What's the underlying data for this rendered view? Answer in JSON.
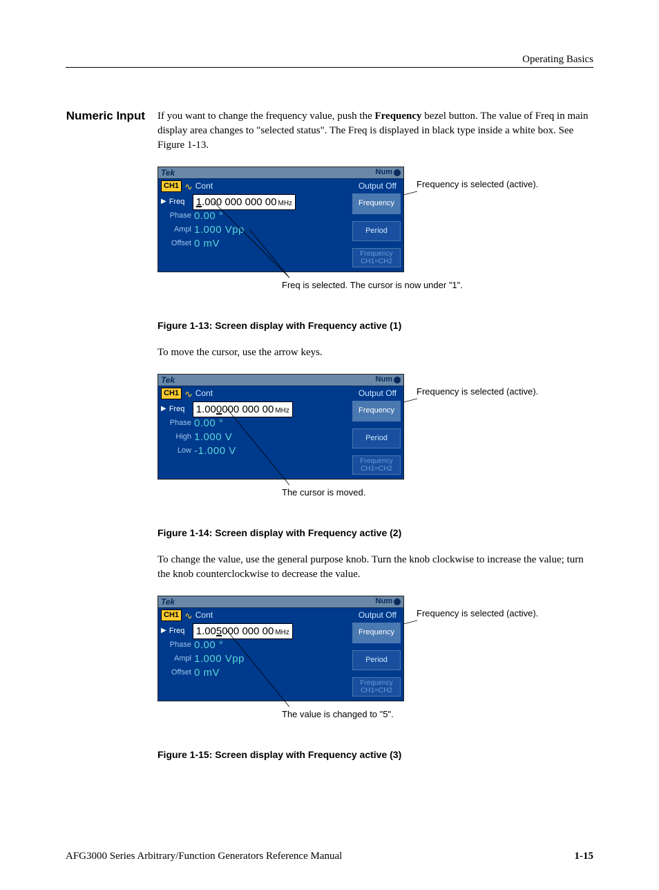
{
  "header": {
    "title": "Operating Basics"
  },
  "section": {
    "title": "Numeric Input",
    "para1_a": "If you want to change the frequency value, push the ",
    "para1_bold": "Frequency",
    "para1_b": " bezel button. The value of Freq in main display area changes to \"selected status\". The Freq is displayed in black type inside a white box. See Figure 1-13."
  },
  "fig1": {
    "top_brand": "Tek",
    "top_num": "Num",
    "ch1": "CH1",
    "cont": "Cont",
    "output": "Output Off",
    "freq_label": "Freq",
    "freq_value_lead": "1",
    "freq_value_rest": ".000 000 000 00",
    "freq_unit": "MHz",
    "phase_label": "Phase",
    "phase_value": "0.00 °",
    "ampl_label": "Ampl",
    "ampl_value": "1.000 Vpp",
    "offset_label": "Offset",
    "offset_value": "0 mV",
    "menu_freq": "Frequency",
    "menu_period": "Period",
    "menu_fcc": "Frequency\nCH1=CH2",
    "side_annot": "Frequency is selected (active).",
    "below_annot": "Freq is selected. The cursor is now under \"1\".",
    "caption": "Figure 1-13: Screen display with Frequency active (1)"
  },
  "para2": "To move the cursor, use the arrow keys.",
  "fig2": {
    "top_brand": "Tek",
    "top_num": "Num",
    "ch1": "CH1",
    "cont": "Cont",
    "output": "Output Off",
    "freq_label": "Freq",
    "freq_value_pre": "1.00",
    "freq_value_cursor": "0",
    "freq_value_post": " 000 000 00",
    "freq_unit": "MHz",
    "phase_label": "Phase",
    "phase_value": "0.00 °",
    "high_label": "High",
    "high_value": "1.000 V",
    "low_label": "Low",
    "low_value": "-1.000 V",
    "menu_freq": "Frequency",
    "menu_period": "Period",
    "menu_fcc": "Frequency\nCH1=CH2",
    "side_annot": "Frequency is selected (active).",
    "below_annot": "The cursor is moved.",
    "caption": "Figure 1-14: Screen display with Frequency active (2)"
  },
  "para3": "To change the value, use the general purpose knob. Turn the knob clockwise to increase the value; turn the knob counterclockwise to decrease the value.",
  "fig3": {
    "top_brand": "Tek",
    "top_num": "Num",
    "ch1": "CH1",
    "cont": "Cont",
    "output": "Output Off",
    "freq_label": "Freq",
    "freq_value_pre": "1.00",
    "freq_value_cursor": "5",
    "freq_value_post": " 000 000 00",
    "freq_unit": "MHz",
    "phase_label": "Phase",
    "phase_value": "0.00 °",
    "ampl_label": "Ampl",
    "ampl_value": "1.000 Vpp",
    "offset_label": "Offset",
    "offset_value": "0 mV",
    "menu_freq": "Frequency",
    "menu_period": "Period",
    "menu_fcc": "Frequency\nCH1=CH2",
    "side_annot": "Frequency is selected (active).",
    "below_annot": "The value is changed to \"5\".",
    "caption": "Figure 1-15: Screen display with Frequency active (3)"
  },
  "footer": {
    "doc": "AFG3000 Series Arbitrary/Function Generators Reference Manual",
    "page": "1-15"
  }
}
